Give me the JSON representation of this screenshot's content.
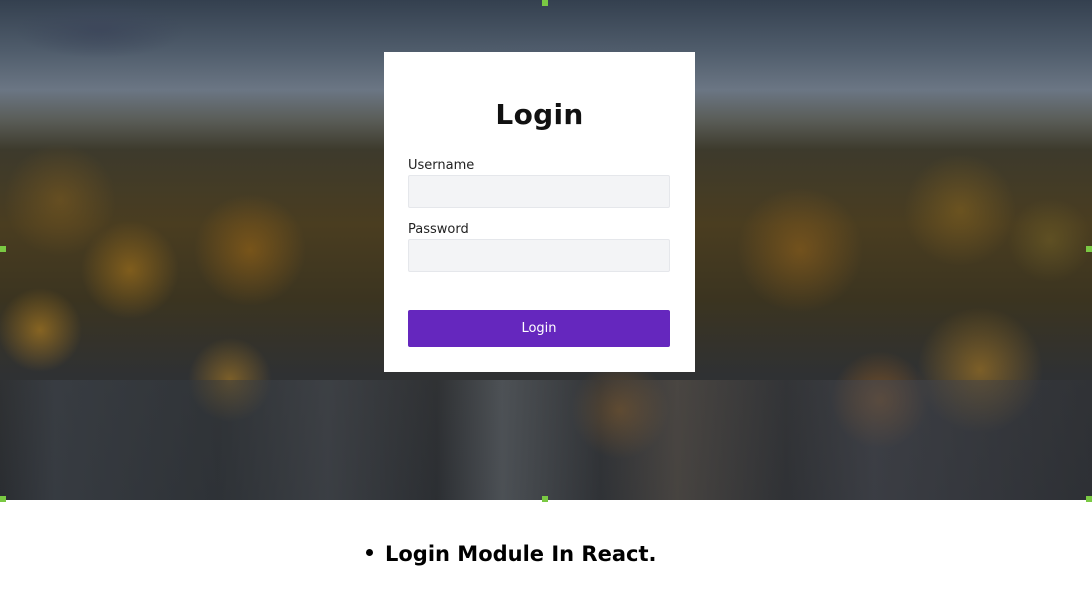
{
  "login_card": {
    "title": "Login",
    "username_label": "Username",
    "username_value": "",
    "password_label": "Password",
    "password_value": "",
    "submit_label": "Login"
  },
  "caption": {
    "text": "Login Module In React."
  },
  "colors": {
    "button_background": "#6527be",
    "button_text": "#ffffff",
    "input_background": "#f3f4f6",
    "card_background": "#ffffff",
    "selection_handle": "#7ac943"
  },
  "icons": {
    "caption_bullet": "bullet-dot-icon"
  }
}
